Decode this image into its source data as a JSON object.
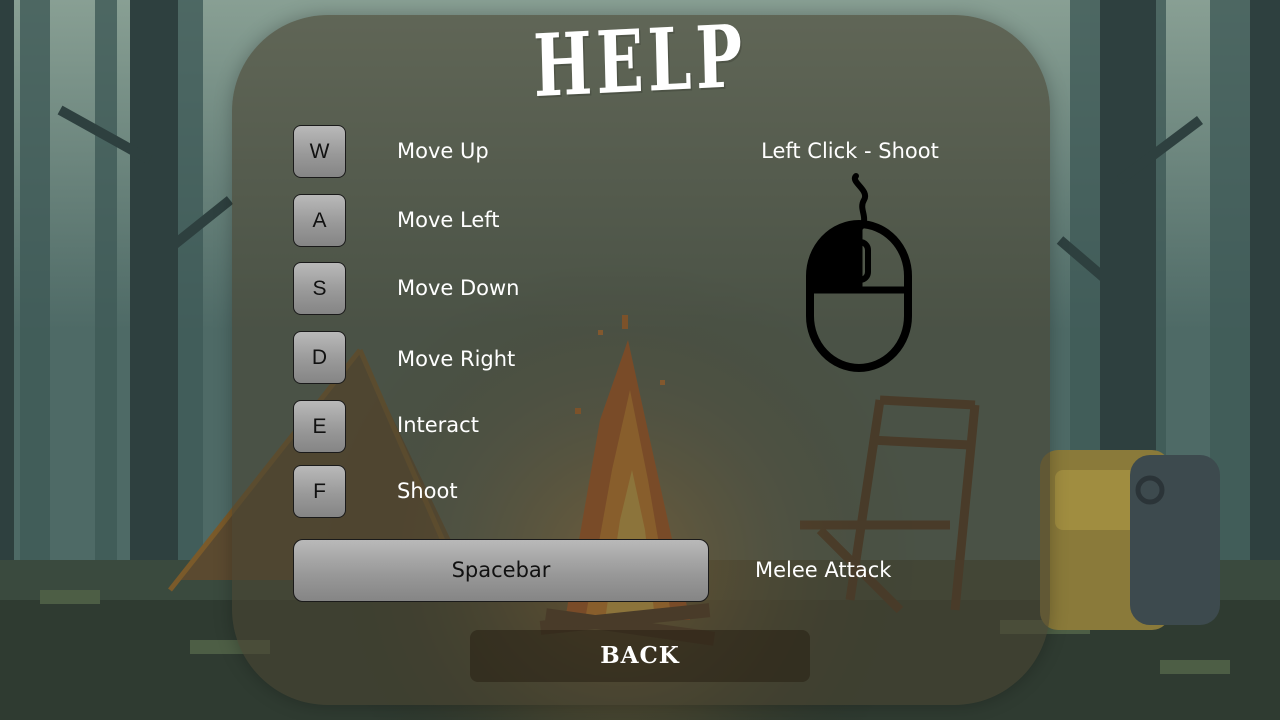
{
  "screen": {
    "title": "HELP"
  },
  "controls": [
    {
      "key": "W",
      "action": "Move Up"
    },
    {
      "key": "A",
      "action": "Move Left"
    },
    {
      "key": "S",
      "action": "Move Down"
    },
    {
      "key": "D",
      "action": "Move Right"
    },
    {
      "key": "E",
      "action": "Interact"
    },
    {
      "key": "F",
      "action": "Shoot"
    }
  ],
  "spacebar": {
    "key": "Spacebar",
    "action": "Melee Attack"
  },
  "mouse": {
    "label": "Left Click - Shoot",
    "icon": "mouse-left-click-icon"
  },
  "back_button": {
    "label": "BACK"
  },
  "background": {
    "description_icon": "forest-campfire-background"
  },
  "colors": {
    "panel": "#48443280",
    "key_fill": "#a0a0a0",
    "text": "#ffffff",
    "fire": "#f08a1c"
  }
}
